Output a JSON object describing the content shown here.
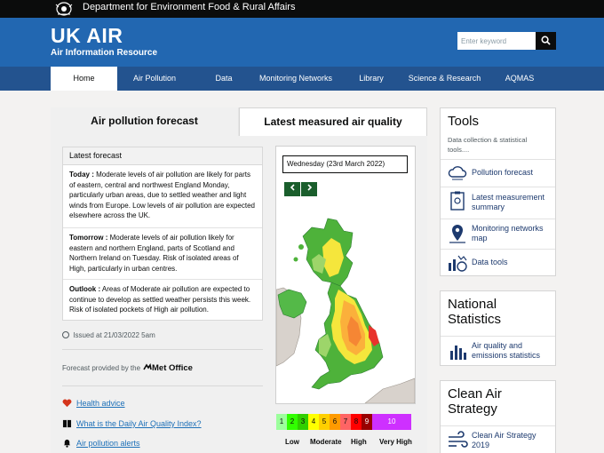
{
  "header": {
    "department": "Department for Environment Food & Rural Affairs",
    "logo": "UK AIR",
    "tagline": "Air Information Resource",
    "search_placeholder": "Enter keyword",
    "search_icon": "search-icon"
  },
  "nav": [
    "Home",
    "Air Pollution",
    "Data",
    "Monitoring Networks",
    "Library",
    "Science & Research",
    "AQMAS"
  ],
  "tabs": [
    "Air pollution forecast",
    "Latest measured air quality"
  ],
  "forecast": {
    "heading": "Latest forecast",
    "today_label": "Today :",
    "today_text": "Moderate levels of air pollution are likely for parts of eastern, central and northwest England Monday, particularly urban areas, due to settled weather and light winds from Europe. Low levels of air pollution are expected elsewhere across the UK.",
    "tomorrow_label": "Tomorrow :",
    "tomorrow_text": "Moderate levels of air pollution likely for eastern and northern England, parts of Scotland and Northern Ireland on Tuesday. Risk of isolated areas of High, particularly in urban centres.",
    "outlook_label": "Outlook :",
    "outlook_text": "Areas of Moderate air pollution are expected to continue to develop as settled weather persists this week. Risk of isolated pockets of High air pollution.",
    "issued": "Issued at 21/03/2022 5am",
    "provided_by": "Forecast provided by the",
    "provider": "Met Office"
  },
  "links": [
    "Health advice",
    "What is the Daily Air Quality Index?",
    "Air pollution alerts"
  ],
  "map": {
    "date": "Wednesday (23rd March 2022)",
    "prev_icon": "chevron-left-icon",
    "next_icon": "chevron-right-icon"
  },
  "scale": {
    "bands": [
      {
        "label": "1",
        "color": "#9cff9c"
      },
      {
        "label": "2",
        "color": "#31ff00"
      },
      {
        "label": "3",
        "color": "#31cf00"
      },
      {
        "label": "4",
        "color": "#ffff00"
      },
      {
        "label": "5",
        "color": "#ffcf00"
      },
      {
        "label": "6",
        "color": "#ff9a00"
      },
      {
        "label": "7",
        "color": "#ff6464"
      },
      {
        "label": "8",
        "color": "#ff0000"
      },
      {
        "label": "9",
        "color": "#990000"
      },
      {
        "label": "10",
        "color": "#ce30ff"
      }
    ],
    "labels": [
      "Low",
      "Moderate",
      "High",
      "Very High"
    ]
  },
  "tools": {
    "title": "Tools",
    "subtitle": "Data collection & statistical tools....",
    "items": [
      "Pollution forecast",
      "Latest measurement summary",
      "Monitoring networks map",
      "Data tools"
    ]
  },
  "national": {
    "title": "National Statistics",
    "item": "Air quality and emissions statistics"
  },
  "clean": {
    "title": "Clean Air Strategy",
    "item": "Clean Air Strategy 2019"
  },
  "colors": {
    "masthead": "#2267b1",
    "nav": "#23538f",
    "link": "#1d70b8",
    "arrow": "#1a5e2c"
  }
}
